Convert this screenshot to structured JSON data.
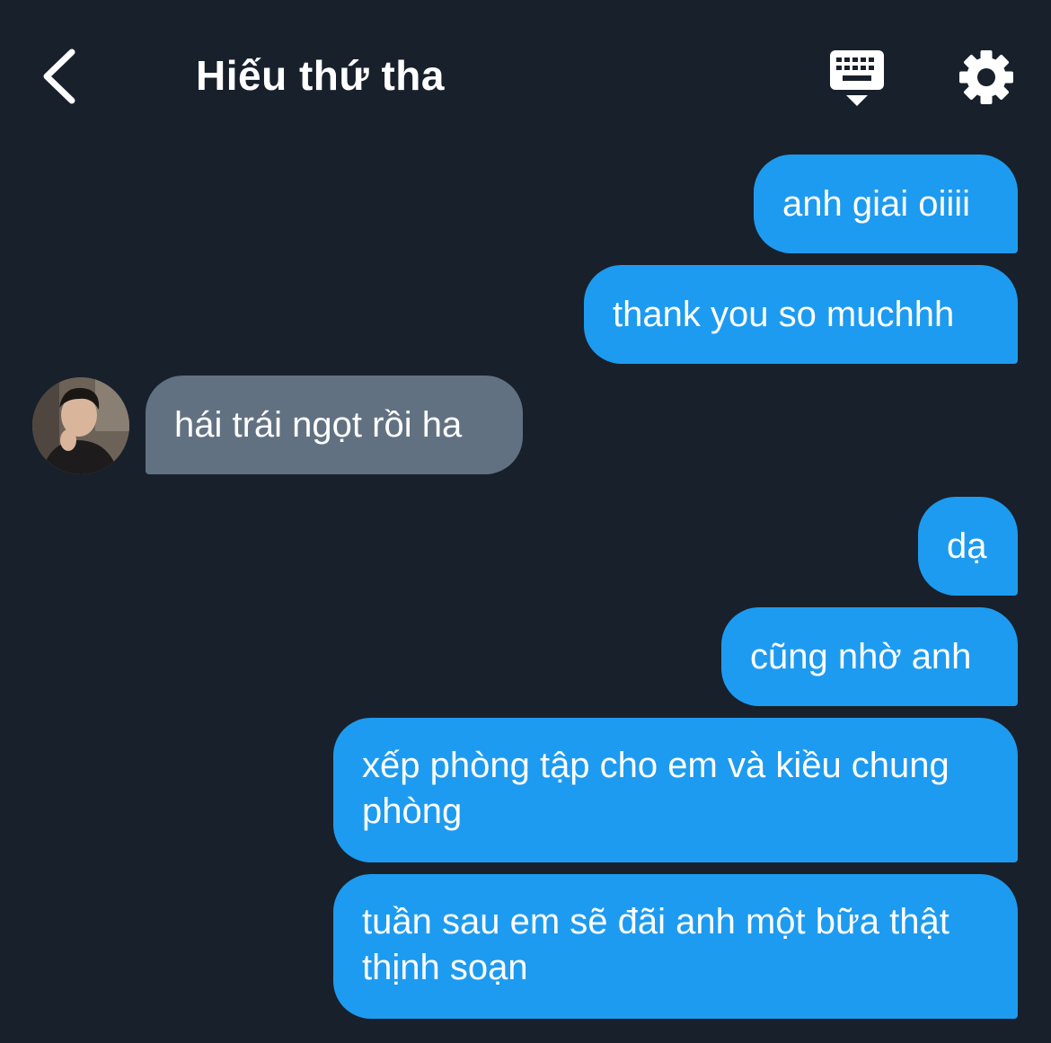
{
  "header": {
    "title": "Hiếu thứ tha"
  },
  "messages": [
    {
      "sender": "me",
      "text": "anh giai oiiii"
    },
    {
      "sender": "me",
      "text": "thank you so muchhh"
    },
    {
      "sender": "them",
      "text": "hái trái ngọt rồi ha"
    },
    {
      "sender": "me",
      "text": "dạ"
    },
    {
      "sender": "me",
      "text": "cũng nhờ anh"
    },
    {
      "sender": "me",
      "text": "xếp phòng tập cho em và kiều chung phòng"
    },
    {
      "sender": "me",
      "text": "tuần sau em sẽ đãi anh một bữa thật thịnh soạn"
    }
  ],
  "icons": {
    "back": "chevron-left-icon",
    "keyboard": "keyboard-icon",
    "settings": "gear-icon",
    "avatar": "contact-avatar"
  },
  "colors": {
    "background": "#18202b",
    "outgoing_bubble": "#1d9bf0",
    "incoming_bubble": "#617181",
    "text": "#ffffff"
  }
}
